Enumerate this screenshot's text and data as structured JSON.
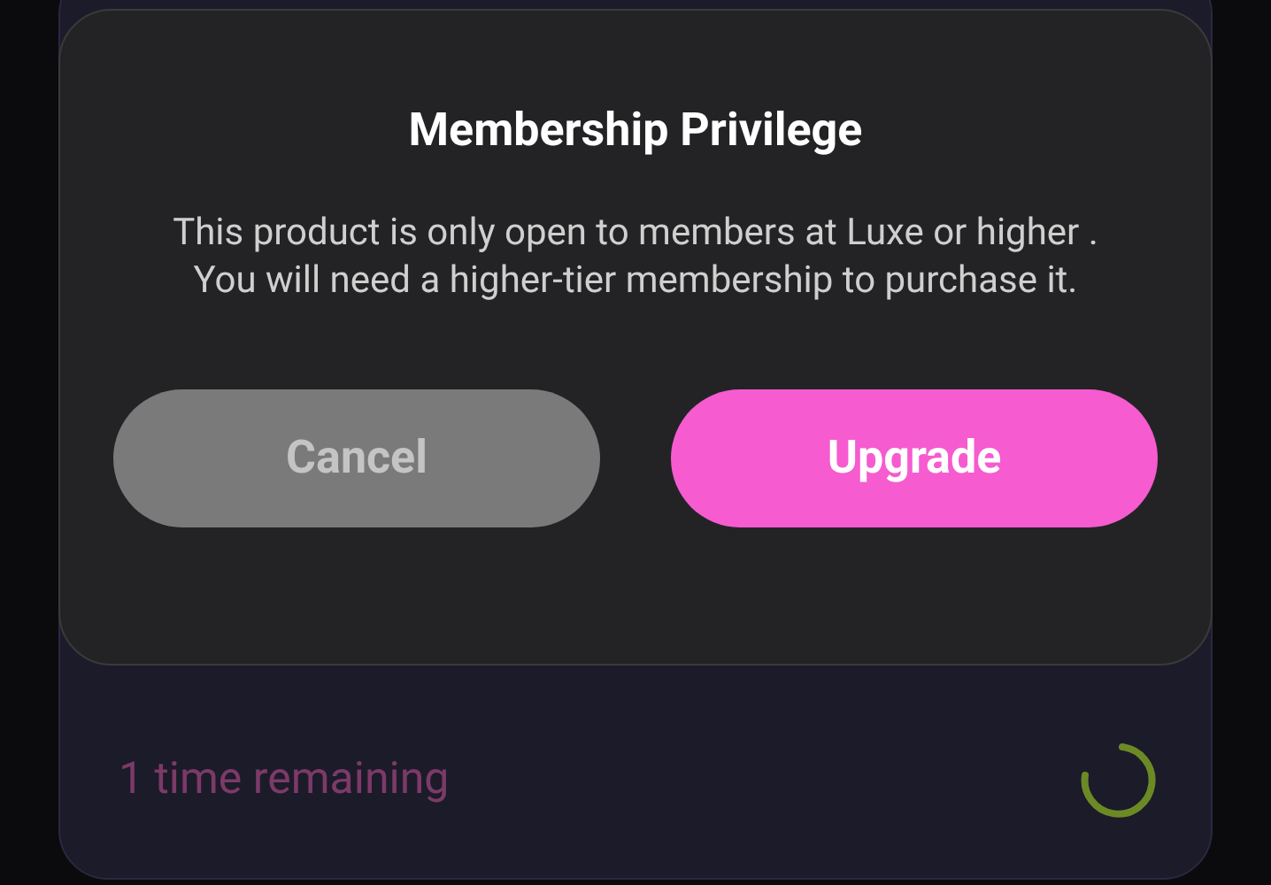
{
  "background_card": {
    "remaining": "1 time remaining"
  },
  "dialog": {
    "title": "Membership Privilege",
    "message": "This product is only open to members at Luxe or higher . You will need a higher-tier membership to purchase it.",
    "buttons": [
      {
        "label": "Cancel",
        "kind": "secondary"
      },
      {
        "label": "Upgrade",
        "kind": "primary"
      }
    ]
  }
}
